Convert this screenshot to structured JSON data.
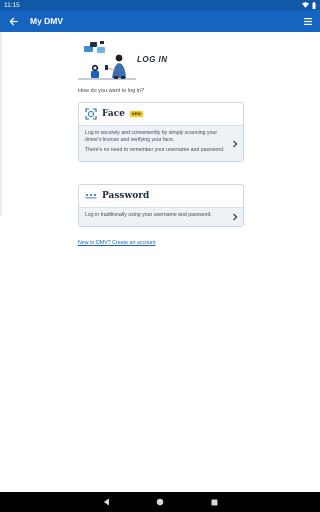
{
  "status_bar": {
    "time": "11:15",
    "icons": [
      "wifi-icon",
      "battery-icon"
    ]
  },
  "app_bar": {
    "title": "My DMV",
    "back_icon": "arrow-left-icon",
    "menu_icon": "hamburger-icon"
  },
  "login": {
    "hero_title": "LOG IN",
    "prompt": "How do you want to log in?",
    "options": [
      {
        "name": "Face",
        "badge": "NEW",
        "icon": "face-scan-icon",
        "paragraphs": [
          "Log in securely and conveniently by simply scanning your driver's license and verifying your face.",
          "There's no need to remember your username and password."
        ]
      },
      {
        "name": "Password",
        "icon": "password-dots-icon",
        "paragraphs": [
          "Log in traditionally using your username and password."
        ]
      }
    ],
    "create_account_link": "New to DMV? Create an account"
  },
  "colors": {
    "brand_blue": "#1565c0",
    "badge_yellow": "#f5c518",
    "card_body_bg": "#eef2f6"
  }
}
